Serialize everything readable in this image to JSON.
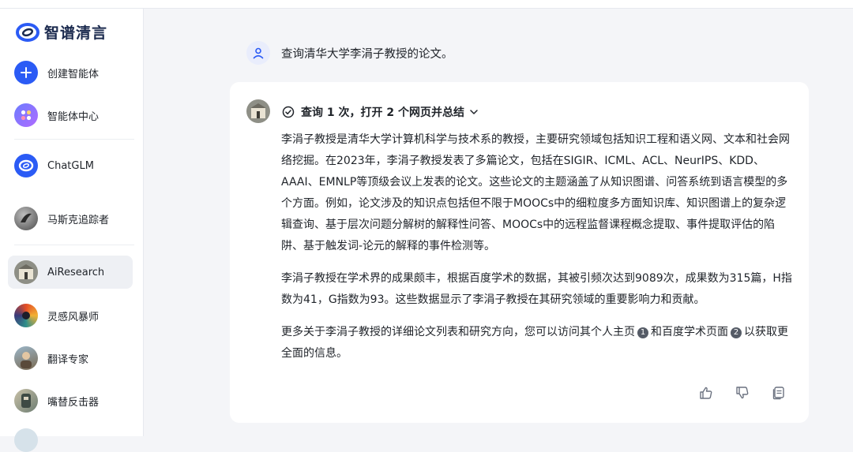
{
  "brand": {
    "name": "智谱清言"
  },
  "sidebar": {
    "items": [
      {
        "label": "创建智能体",
        "icon": "plus-icon"
      },
      {
        "label": "智能体中心",
        "icon": "apps-icon"
      },
      {
        "label": "ChatGLM",
        "icon": "chatglm-logo"
      },
      {
        "label": "马斯克追踪者",
        "icon": "avatar-musk"
      },
      {
        "label": "AiResearch",
        "icon": "avatar-building",
        "active": true
      },
      {
        "label": "灵感风暴师",
        "icon": "avatar-swirl"
      },
      {
        "label": "翻译专家",
        "icon": "avatar-translate"
      },
      {
        "label": "嘴替反击器",
        "icon": "avatar-comeback"
      }
    ]
  },
  "conversation": {
    "user_message": "查询清华大学李涓子教授的论文。",
    "summary_label": "查询 1 次，打开 2 个网页并总结",
    "paragraphs": [
      "李涓子教授是清华大学计算机科学与技术系的教授，主要研究领域包括知识工程和语义网、文本和社会网络挖掘。在2023年，李涓子教授发表了多篇论文，包括在SIGIR、ICML、ACL、NeurIPS、KDD、AAAI、EMNLP等顶级会议上发表的论文。这些论文的主题涵盖了从知识图谱、问答系统到语言模型的多个方面。例如，论文涉及的知识点包括但不限于MOOCs中的细粒度多方面知识库、知识图谱上的复杂逻辑查询、基于层次问题分解树的解释性问答、MOOCs中的远程监督课程概念提取、事件提取评估的陷阱、基于触发词-论元的解释的事件检测等。",
      "李涓子教授在学术界的成果颇丰，根据百度学术的数据，其被引频次达到9089次，成果数为315篇，H指数为41，G指数为93。这些数据显示了李涓子教授在其研究领域的重要影响力和贡献。"
    ],
    "closing": {
      "part1": "更多关于李涓子教授的详细论文列表和研究方向，您可以访问其个人主页",
      "cite1": "1",
      "part2": "和百度学术页面",
      "cite2": "2",
      "part3": "以获取更全面的信息。"
    },
    "actions": [
      "thumbs-up-icon",
      "thumbs-down-icon",
      "copy-icon"
    ]
  },
  "colors": {
    "accent": "#2b5bf5",
    "card_bg": "#ffffff",
    "page_bg": "#f4f5f8"
  }
}
